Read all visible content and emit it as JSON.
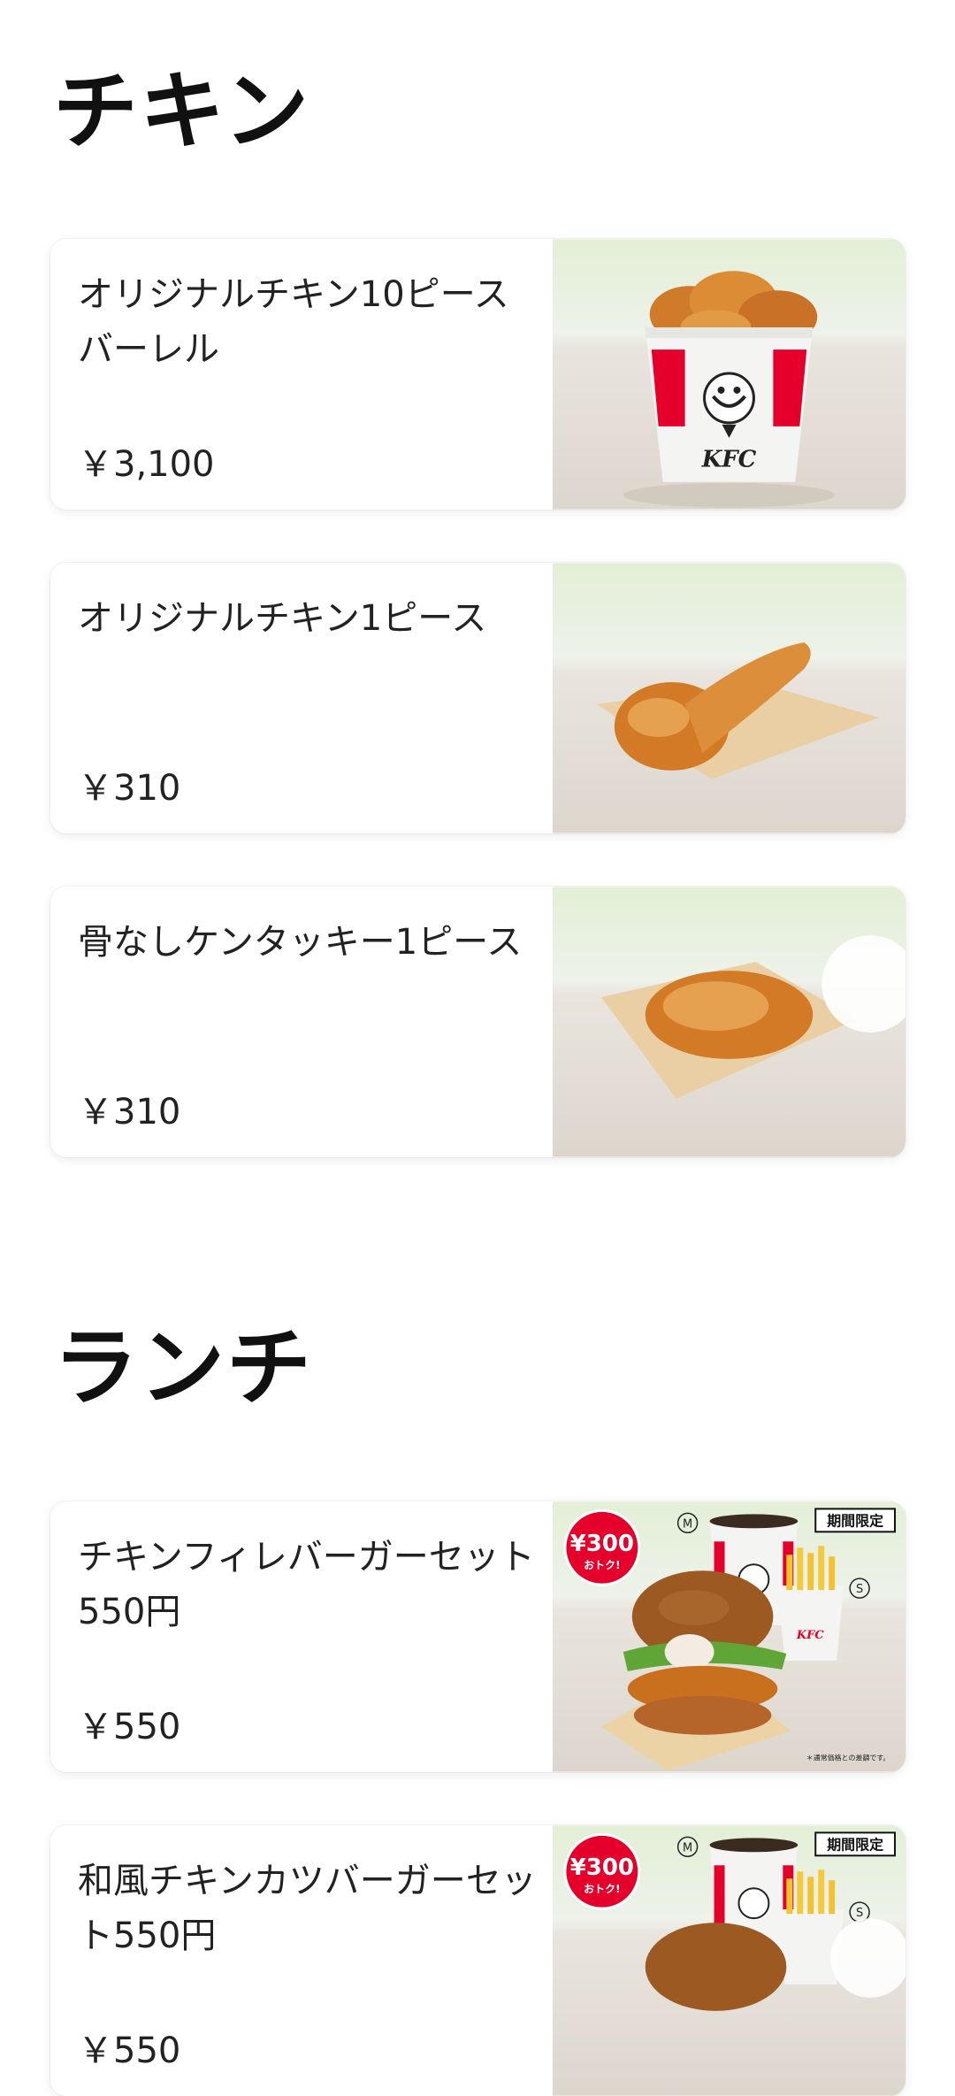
{
  "sections": [
    {
      "title": "チキン",
      "items": [
        {
          "name": "オリジナルチキン10ピースバーレル",
          "price": "￥3,100",
          "image_icon": "chicken-bucket-icon"
        },
        {
          "name": "オリジナルチキン1ピース",
          "price": "￥310",
          "image_icon": "chicken-drumstick-icon"
        },
        {
          "name": "骨なしケンタッキー1ピース",
          "price": "￥310",
          "image_icon": "boneless-chicken-icon"
        }
      ]
    },
    {
      "title": "ランチ",
      "items": [
        {
          "name": "チキンフィレバーガーセット550円",
          "price": "￥550",
          "image_icon": "burger-set-icon",
          "image_text": {
            "discount": "¥300",
            "discount_sub": "おトク!",
            "limited": "期間限定",
            "size_m": "M",
            "size_s": "S",
            "note": "＊通常価格との差額です。"
          }
        },
        {
          "name": "和風チキンカツバーガーセット550円",
          "price": "￥550",
          "image_icon": "burger-set-icon",
          "image_text": {
            "discount": "¥300",
            "discount_sub": "おトク!",
            "limited": "期間限定",
            "size_m": "M",
            "size_s": "S"
          }
        }
      ]
    }
  ],
  "colors": {
    "kfc_red": "#e4002b",
    "fried": "#d9822b",
    "card_bg": "#ffffff",
    "text": "#222222"
  }
}
